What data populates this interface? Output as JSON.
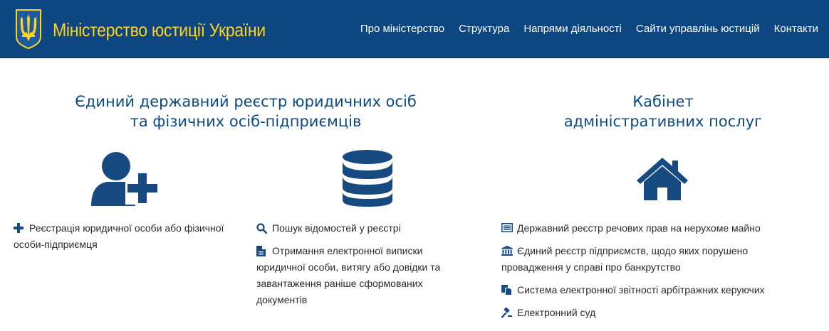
{
  "header": {
    "brand": "Міністерство юстиції України",
    "nav": [
      "Про міністерство",
      "Структура",
      "Напрями діяльності",
      "Сайти управлінь юстицій",
      "Контакти"
    ]
  },
  "registry": {
    "title_line1": "Єдиний державний реєстр юридичних осіб",
    "title_line2": "та фізичних осіб-підприємців",
    "registration": "Реєстрація юридичної особи або фізичної особи-підприємця",
    "search": "Пошук відомостей у реєстрі",
    "extract": "Отримання електронної виписки юридичної особи, витягу або довідки та завантаження раніше сформованих документів"
  },
  "cabinet": {
    "title_line1": "Кабінет",
    "title_line2": "адміністративних послуг",
    "items": [
      "Державний реєстр речових прав на нерухоме майно",
      "Єдиний реєстр підприємств, щодо яких порушено провадження у справі про банкрутство",
      "Система електронної звітності арбітражних керуючих",
      "Електронний суд"
    ]
  },
  "colors": {
    "header_bg": "#0d4680",
    "brand_yellow": "#ffd21d",
    "title_blue": "#0b4a86",
    "icon_blue": "#164a80"
  },
  "icons": {
    "logo": "trident-coat-of-arms-icon",
    "registration_big": "user-plus-icon",
    "registry_big": "database-icon",
    "cabinet_big": "home-icon",
    "plus": "plus-icon",
    "search": "search-icon",
    "document": "document-icon",
    "list": "list-icon",
    "bank": "bank-icon",
    "copy": "copy-icon",
    "gavel": "gavel-icon"
  }
}
